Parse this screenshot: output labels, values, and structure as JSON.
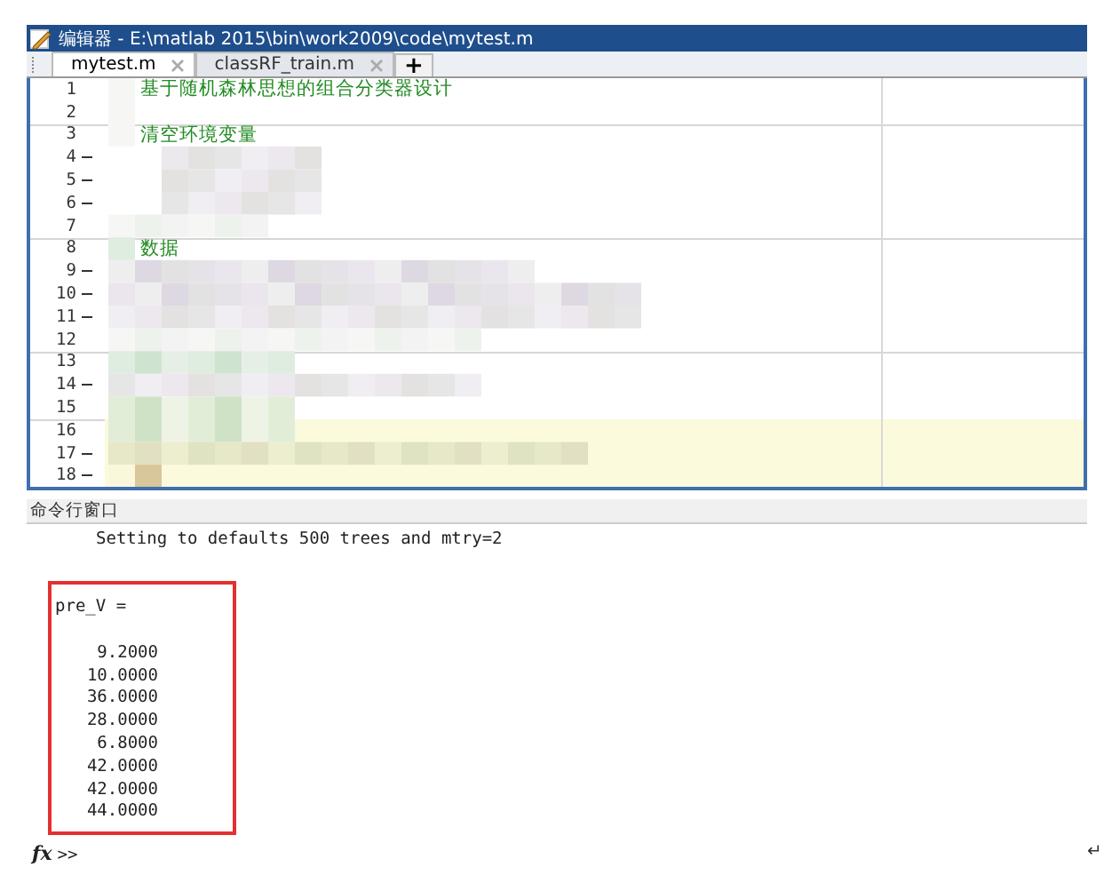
{
  "window": {
    "title": "编辑器 - E:\\matlab 2015\\bin\\work2009\\code\\mytest.m"
  },
  "tabs": [
    {
      "label": "mytest.m",
      "selected": true
    },
    {
      "label": "classRF_train.m",
      "selected": false
    }
  ],
  "new_tab_button": "+",
  "editor": {
    "lines": [
      {
        "number": "1",
        "executable": false,
        "section_start": false,
        "highlighted": false,
        "code": "基于随机森林思想的组合分类器设计"
      },
      {
        "number": "2",
        "executable": false,
        "section_start": false,
        "highlighted": false
      },
      {
        "number": "3",
        "executable": false,
        "section_start": true,
        "highlighted": false,
        "code": "清空环境变量"
      },
      {
        "number": "4",
        "executable": true,
        "section_start": false,
        "highlighted": false
      },
      {
        "number": "5",
        "executable": true,
        "section_start": false,
        "highlighted": false
      },
      {
        "number": "6",
        "executable": true,
        "section_start": false,
        "highlighted": false
      },
      {
        "number": "7",
        "executable": false,
        "section_start": false,
        "highlighted": false
      },
      {
        "number": "8",
        "executable": false,
        "section_start": true,
        "highlighted": false,
        "code": "数据"
      },
      {
        "number": "9",
        "executable": true,
        "section_start": false,
        "highlighted": false
      },
      {
        "number": "10",
        "executable": true,
        "section_start": false,
        "highlighted": false
      },
      {
        "number": "11",
        "executable": true,
        "section_start": false,
        "highlighted": false
      },
      {
        "number": "12",
        "executable": false,
        "section_start": false,
        "highlighted": false
      },
      {
        "number": "13",
        "executable": false,
        "section_start": true,
        "highlighted": false
      },
      {
        "number": "14",
        "executable": true,
        "section_start": false,
        "highlighted": false
      },
      {
        "number": "15",
        "executable": false,
        "section_start": false,
        "highlighted": false
      },
      {
        "number": "16",
        "executable": false,
        "section_start": true,
        "highlighted": true
      },
      {
        "number": "17",
        "executable": true,
        "section_start": false,
        "highlighted": true
      },
      {
        "number": "18",
        "executable": true,
        "section_start": false,
        "highlighted": true
      }
    ]
  },
  "command_window": {
    "title": "命令行窗口",
    "output": "Setting to defaults 500 trees and mtry=2",
    "result_name": "pre_V =",
    "result_values": [
      "9.2000",
      "10.0000",
      "36.0000",
      "28.0000",
      "6.8000",
      "42.0000",
      "42.0000",
      "44.0000"
    ],
    "prompt_icon": "fx",
    "prompt": ">>"
  },
  "paragraph_mark": "↵"
}
